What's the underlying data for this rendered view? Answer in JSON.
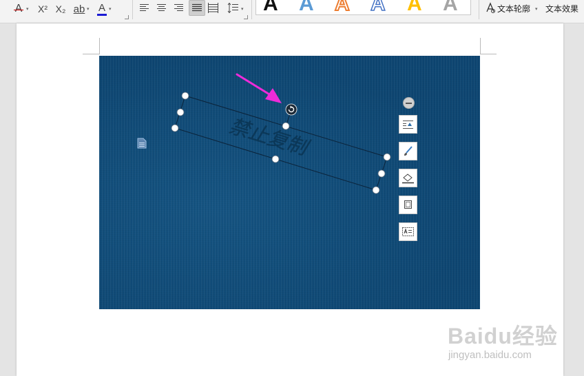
{
  "ribbon": {
    "font_color_hex": "#1b1bd4",
    "strikethrough_glyph": "A",
    "superscript_glyph": "X²",
    "subscript_glyph": "X₂",
    "phonetic_glyph": "ab",
    "font_color_glyph": "A",
    "gallery_glyphs": [
      "A",
      "A",
      "A",
      "A",
      "A",
      "A"
    ],
    "gallery_colors": [
      "#111111",
      "#5b9bd5",
      "#ed7d31",
      "#4472c4",
      "#ffc000",
      "#a5a5a5"
    ],
    "text_outline_label": "文本轮廓",
    "text_effect_label": "文本效果"
  },
  "document": {
    "watermark_text": "禁止复制",
    "image_color_hex": "#0f4b78",
    "arrow_color_hex": "#ee2bd9"
  },
  "float_toolbar": {
    "icons": [
      "layout-options-icon",
      "brush-icon",
      "fill-icon",
      "crop-icon",
      "text-box-icon"
    ]
  },
  "site_watermark": {
    "logo": "Baidu经验",
    "url": "jingyan.baidu.com"
  }
}
